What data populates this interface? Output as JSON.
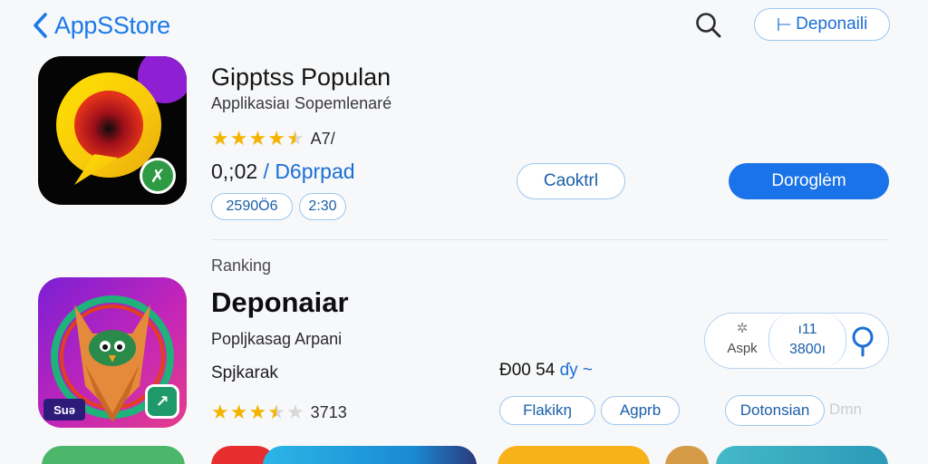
{
  "header": {
    "back_label": "AppSStore",
    "search_icon": "search-icon",
    "top_pill_label": "Deponaili"
  },
  "app1": {
    "title": "Gipptss Populan",
    "subtitle": "Applikasiaı Sopemlenaré",
    "rating_stars": 4.5,
    "rating_text": "A7/",
    "price_main": "0,;02",
    "price_link": "/ D6prpad",
    "chips": [
      "2590Ö6",
      "2:30"
    ],
    "secondary_button": "Caoktrl",
    "primary_button": "Doroglėm",
    "icon_colors": {
      "ring": "#f7d20c",
      "inner": "#d51414",
      "badge": "#2e9a44"
    },
    "badge_glyph": "✗"
  },
  "section_label": "Ranking",
  "app2": {
    "title": "Deponaiar",
    "subtitle": "Popljkasag Arpani",
    "developer": "Spjkarak",
    "rating_stars": 3.5,
    "rating_text": "3713",
    "price_main": "Ð00 54",
    "price_link": "ɗy ~",
    "chips": [
      "Flakikŋ",
      "Agprb"
    ],
    "segment": {
      "left": "Aspk",
      "middle_top": "ı11",
      "middle_bottom": "3800ı",
      "right_icon": "search-icon"
    },
    "outline_button": "Dotonsian",
    "fade_text": "Dmn",
    "badge_text": "Suə",
    "icon_colors": {
      "bg": "#8a1fd0",
      "badge": "#1e9a6a"
    }
  },
  "peek_colors": [
    "#4cb76a",
    "#e62e2e",
    "#2bb6e6",
    "#f7b21a",
    "#d59b47",
    "#44b9c8"
  ]
}
